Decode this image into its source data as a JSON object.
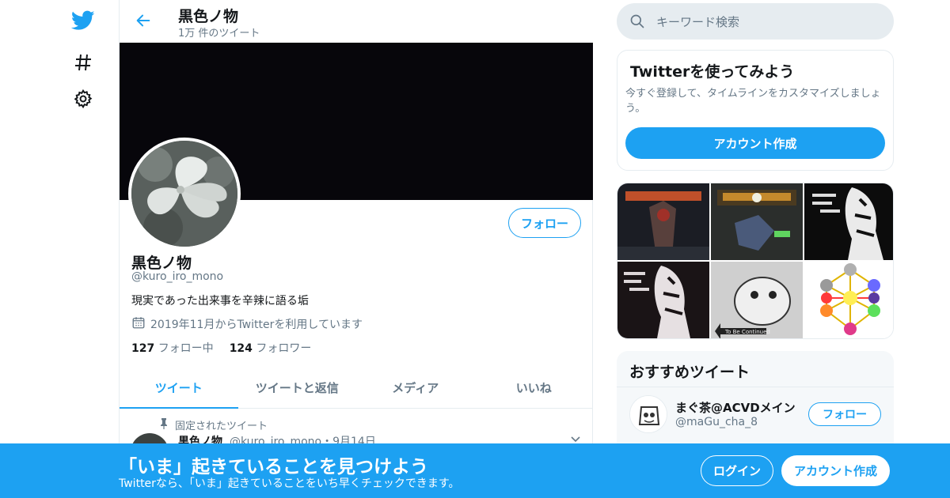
{
  "nav": {
    "icons": [
      "twitter-bird-icon",
      "hashtag-icon",
      "gear-icon"
    ]
  },
  "header": {
    "title": "黒色ノ物",
    "tweet_count": "1万 件のツイート"
  },
  "profile": {
    "name": "黒色ノ物",
    "handle": "@kuro_iro_mono",
    "bio": "現実であった出来事を辛辣に語る垢",
    "joined": "2019年11月からTwitterを利用しています",
    "following_count": "127",
    "following_label": "フォロー中",
    "followers_count": "124",
    "followers_label": "フォロワー",
    "follow_button": "フォロー"
  },
  "tabs": [
    {
      "label": "ツイート",
      "active": true
    },
    {
      "label": "ツイートと返信",
      "active": false
    },
    {
      "label": "メディア",
      "active": false
    },
    {
      "label": "いいね",
      "active": false
    }
  ],
  "pinned_tweet": {
    "pinned_label": "固定されたツイート",
    "name": "黒色ノ物",
    "meta": "@kuro_iro_mono・9月14日"
  },
  "search": {
    "placeholder": "キーワード検索"
  },
  "signup_card": {
    "title": "Twitterを使ってみよう",
    "text": "今すぐ登録して、タイムラインをカスタマイズしましょう。",
    "button": "アカウント作成"
  },
  "media_grid": {
    "caption_text": "To Be Continued"
  },
  "recommended": {
    "title": "おすすめツイート",
    "user_name": "まぐ茶@ACVDメイン",
    "user_handle": "@maGu_cha_8",
    "follow_button": "フォロー"
  },
  "bottom_bar": {
    "title": "「いま」起きていることを見つけよう",
    "subtitle": "Twitterなら、「いま」起きていることをいち早くチェックできます。",
    "login": "ログイン",
    "signup": "アカウント作成"
  },
  "colors": {
    "accent": "#1da1f2",
    "muted": "#657786",
    "border": "#e6ecf0"
  }
}
